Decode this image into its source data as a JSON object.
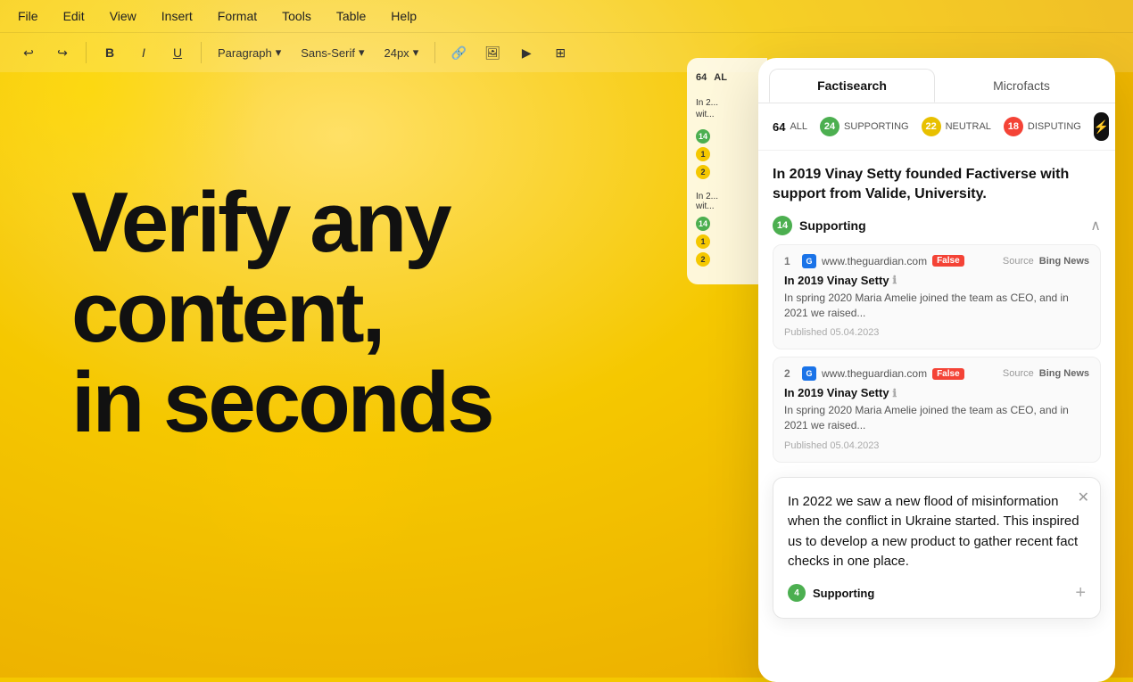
{
  "background": {
    "color": "#f5c800"
  },
  "menu": {
    "items": [
      "File",
      "Edit",
      "View",
      "Insert",
      "Format",
      "Tools",
      "Table",
      "Help"
    ]
  },
  "toolbar": {
    "paragraph_label": "Paragraph",
    "font_label": "Sans-Serif",
    "size_label": "24px"
  },
  "hero": {
    "line1": "Verify any",
    "line2": "content,",
    "line3": "in seconds"
  },
  "sidebar": {
    "tabs": [
      "Factisearch",
      "Microfacts"
    ],
    "active_tab": 0,
    "stats": {
      "all_count": "64",
      "all_label": "ALL",
      "supporting_count": "24",
      "supporting_label": "SUPPORTING",
      "neutral_count": "22",
      "neutral_label": "NEUTRAL",
      "disputing_count": "18",
      "disputing_label": "DISPUTING"
    },
    "claim1": {
      "title": "In 2019 Vinay Setty founded Factiverse with support from Valide, University.",
      "supporting_count": "14",
      "supporting_label": "Supporting",
      "sources": [
        {
          "num": "1",
          "domain": "www.theguardian.com",
          "verdict": "False",
          "source_label": "Source",
          "source_name": "Bing News",
          "title": "In 2019 Vinay Setty",
          "excerpt": "In spring 2020 Maria Amelie joined the team as CEO, and in 2021 we raised...",
          "date": "Published 05.04.2023"
        },
        {
          "num": "2",
          "domain": "www.theguardian.com",
          "verdict": "False",
          "source_label": "Source",
          "source_name": "Bing News",
          "title": "In 2019 Vinay Setty",
          "excerpt": "In spring 2020 Maria Amelie joined the team as CEO, and in 2021 we raised...",
          "date": "Published 05.04.2023"
        }
      ]
    },
    "claim2": {
      "title": "In 2022 we saw a new flood of misinformation when the conflict in Ukraine started. This inspired us to develop a new product to gather recent fact checks in one place.",
      "supporting_count": "4",
      "supporting_label": "Supporting"
    }
  },
  "editor_doc": {
    "all_count": "64",
    "all_label": "AL",
    "supporting_count": "14",
    "item1": "1",
    "item2": "2"
  }
}
